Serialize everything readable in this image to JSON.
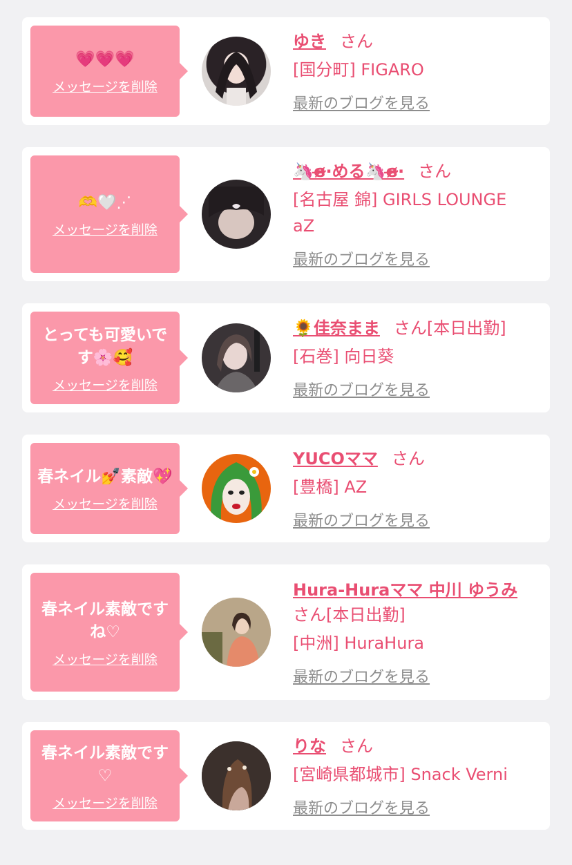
{
  "colors": {
    "background": "#f1f1f3",
    "card": "#ffffff",
    "bubble": "#fb98aa",
    "accent": "#e94e72",
    "muted": "#8d8d8d"
  },
  "common": {
    "delete_label": "メッセージを削除",
    "blog_label": "最新のブログを見る"
  },
  "items": [
    {
      "message": "💗💗💗",
      "name": "ゆき",
      "suffix": "さん",
      "shop": "[国分町] FIGARO"
    },
    {
      "message": "🫶🤍⋰",
      "name": "🦄ɞ̴̶̷·める🦄ɞ̴̶̷·",
      "suffix": "さん",
      "shop": "[名古屋 錦] GIRLS LOUNGE aZ"
    },
    {
      "message": "とっても可愛いです🌸🥰",
      "name": "🌻佳奈まま",
      "suffix": "さん[本日出勤]",
      "shop": "[石巻] 向日葵"
    },
    {
      "message": "春ネイル💅素敵💖",
      "name": "YUCOママ",
      "suffix": "さん",
      "shop": "[豊橋] AZ"
    },
    {
      "message": "春ネイル素敵ですね♡",
      "name": "Hura-Huraママ 中川 ゆうみ",
      "suffix": "さん[本日出勤]",
      "shop": "[中洲] HuraHura"
    },
    {
      "message": "春ネイル素敵です♡",
      "name": "りな",
      "suffix": "さん",
      "shop": "[宮崎県都城市] Snack Verni"
    }
  ]
}
